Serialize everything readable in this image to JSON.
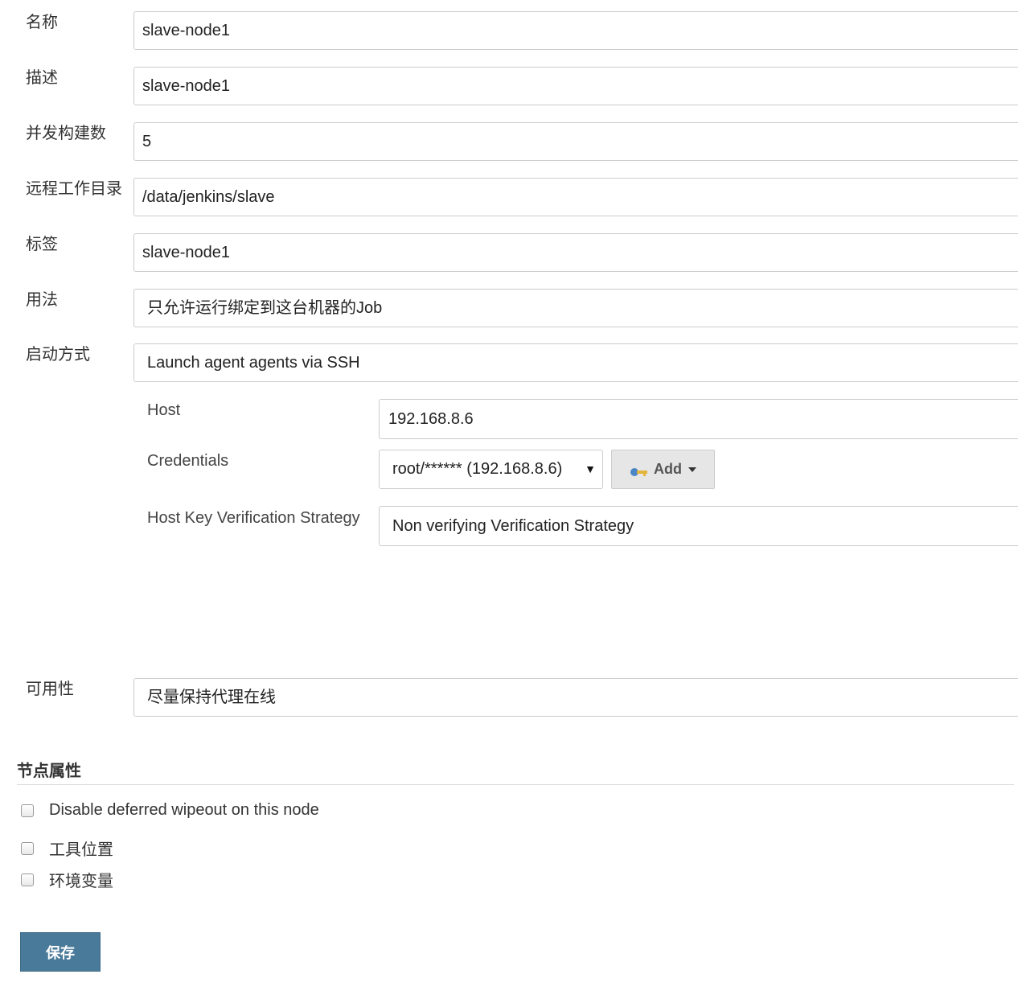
{
  "form": {
    "name": {
      "label": "名称",
      "value": "slave-node1"
    },
    "description": {
      "label": "描述",
      "value": "slave-node1"
    },
    "executors": {
      "label": "并发构建数",
      "value": "5"
    },
    "remote_dir": {
      "label": "远程工作目录",
      "value": "/data/jenkins/slave"
    },
    "labels": {
      "label": "标签",
      "value": "slave-node1"
    },
    "usage": {
      "label": "用法",
      "value": "只允许运行绑定到这台机器的Job"
    },
    "launch": {
      "label": "启动方式",
      "value": "Launch agent agents via SSH"
    },
    "availability": {
      "label": "可用性",
      "value": "尽量保持代理在线"
    }
  },
  "ssh": {
    "host": {
      "label": "Host",
      "value": "192.168.8.6"
    },
    "credentials": {
      "label": "Credentials",
      "value": "root/****** (192.168.8.6)",
      "caret": "▼"
    },
    "add_button": {
      "label": "Add",
      "icon": "key-icon"
    },
    "host_key": {
      "label": "Host Key Verification Strategy",
      "value": "Non verifying Verification Strategy"
    }
  },
  "node_properties": {
    "title": "节点属性",
    "options": [
      {
        "label": "Disable deferred wipeout on this node",
        "checked": false
      },
      {
        "label": "工具位置",
        "checked": false
      },
      {
        "label": "环境变量",
        "checked": false
      }
    ]
  },
  "save_button": {
    "label": "保存",
    "color": "#4a7a9a"
  }
}
